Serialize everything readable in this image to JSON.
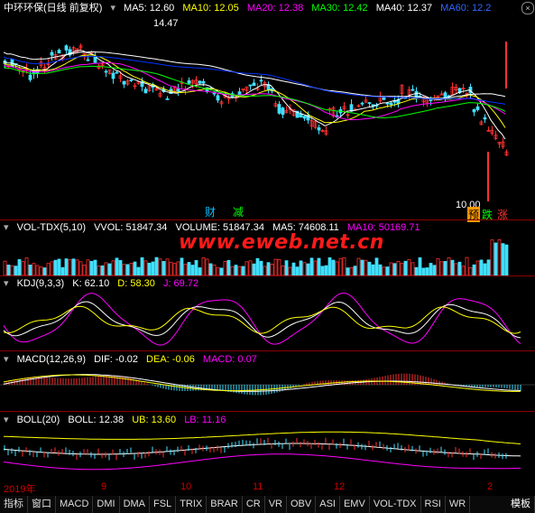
{
  "price": {
    "title": "中环环保(日线 前复权)",
    "ma": [
      {
        "label": "MA5: 12.60",
        "color": "#ffffff"
      },
      {
        "label": "MA10: 12.05",
        "color": "#ffff00"
      },
      {
        "label": "MA20: 12.38",
        "color": "#ff00ff"
      },
      {
        "label": "MA30: 12.42",
        "color": "#00ff00"
      },
      {
        "label": "MA40: 12.37",
        "color": "#ffffff"
      },
      {
        "label": "MA60: 12.2",
        "color": "#0033ff"
      }
    ],
    "high_label": "14.47",
    "low_label": "10.00",
    "markers": [
      {
        "text": "财",
        "color": "#00bfff"
      },
      {
        "text": "减",
        "color": "#00ff00"
      },
      {
        "text": "预",
        "color": "#ff9900"
      },
      {
        "text": "跌",
        "color": "#00ff00"
      },
      {
        "text": "涨",
        "color": "#ff3333"
      }
    ]
  },
  "volume": {
    "name": "VOL-TDX(5,10)",
    "items": [
      {
        "label": "VVOL: 51847.34",
        "color": "#ffffff"
      },
      {
        "label": "VOLUME: 51847.34",
        "color": "#ffffff"
      },
      {
        "label": "MA5: 74608.11",
        "color": "#ffffff"
      },
      {
        "label": "MA10: 50169.71",
        "color": "#ff00ff"
      }
    ]
  },
  "watermark": "www.eweb.net.cn",
  "kdj": {
    "name": "KDJ(9,3,3)",
    "items": [
      {
        "label": "K: 62.10",
        "color": "#ffffff"
      },
      {
        "label": "D: 58.30",
        "color": "#ffff00"
      },
      {
        "label": "J: 69.72",
        "color": "#ff00ff"
      }
    ]
  },
  "macd": {
    "name": "MACD(12,26,9)",
    "items": [
      {
        "label": "DIF: -0.02",
        "color": "#ffffff"
      },
      {
        "label": "DEA: -0.06",
        "color": "#ffff00"
      },
      {
        "label": "MACD: 0.07",
        "color": "#ff00ff"
      }
    ]
  },
  "boll": {
    "name": "BOLL(20)",
    "items": [
      {
        "label": "BOLL: 12.38",
        "color": "#ffffff"
      },
      {
        "label": "UB: 13.60",
        "color": "#ffff00"
      },
      {
        "label": "LB: 11.16",
        "color": "#ff00ff"
      }
    ]
  },
  "time_axis": [
    "2019年",
    "9",
    "10",
    "11",
    "12",
    "2"
  ],
  "tabs": [
    "指标",
    "窗口",
    "MACD",
    "DMI",
    "DMA",
    "FSL",
    "TRIX",
    "BRAR",
    "CR",
    "VR",
    "OBV",
    "ASI",
    "EMV",
    "VOL-TDX",
    "RSI",
    "WR",
    "模板"
  ]
}
